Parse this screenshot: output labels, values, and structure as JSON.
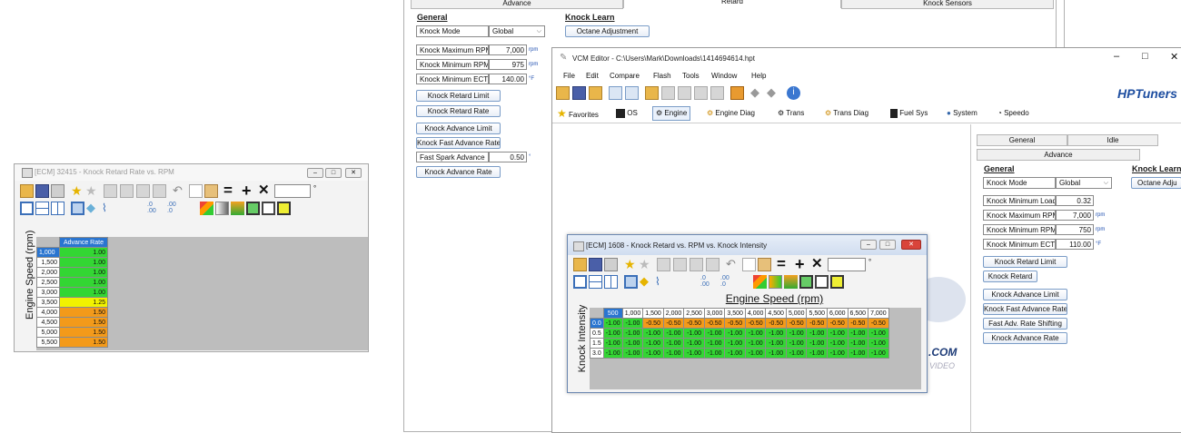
{
  "left_window": {
    "title": "[ECM] 32415 - Knock Retard Rate vs. RPM",
    "axis_label": "Engine Speed (rpm)",
    "column_header": "Advance Rate",
    "rows": [
      {
        "rpm": "1,000",
        "val": "1.00",
        "color": "#33d633"
      },
      {
        "rpm": "1,500",
        "val": "1.00",
        "color": "#33d633"
      },
      {
        "rpm": "2,000",
        "val": "1.00",
        "color": "#33d633"
      },
      {
        "rpm": "2,500",
        "val": "1.00",
        "color": "#33d633"
      },
      {
        "rpm": "3,000",
        "val": "1.00",
        "color": "#33d633"
      },
      {
        "rpm": "3,500",
        "val": "1.25",
        "color": "#f2f200"
      },
      {
        "rpm": "4,000",
        "val": "1.50",
        "color": "#f39a1a"
      },
      {
        "rpm": "4,500",
        "val": "1.50",
        "color": "#f39a1a"
      },
      {
        "rpm": "5,000",
        "val": "1.50",
        "color": "#f39a1a"
      },
      {
        "rpm": "5,500",
        "val": "1.50",
        "color": "#f39a1a"
      }
    ]
  },
  "bg_panel": {
    "tabs": [
      "Advance",
      "Retard",
      "Knock Sensors"
    ],
    "general_header": "General",
    "knock_learn_header": "Knock Learn",
    "knock_mode_label": "Knock Mode",
    "knock_mode_value": "Global",
    "octane_button": "Octane Adjustment",
    "fields": [
      {
        "label": "Knock Maximum RPM",
        "value": "7,000",
        "unit": "rpm"
      },
      {
        "label": "Knock Minimum RPM",
        "value": "975",
        "unit": "rpm"
      },
      {
        "label": "Knock Minimum ECT",
        "value": "140.00",
        "unit": "°F"
      }
    ],
    "buttons": [
      "Knock Retard Limit",
      "Knock Retard Rate",
      "Knock Advance Limit",
      "Knock Fast Advance Rate"
    ],
    "fast_spark_label": "Fast Spark Advance",
    "fast_spark_value": "0.50",
    "fast_spark_unit": "°",
    "advance_rate_button": "Knock Advance Rate"
  },
  "vcm": {
    "title": "VCM Editor - C:\\Users\\Mark\\Downloads\\1414694614.hpt",
    "menu": [
      "File",
      "Edit",
      "Compare",
      "Flash",
      "Tools",
      "Window",
      "Help"
    ],
    "nav": [
      "Favorites",
      "OS",
      "Engine",
      "Engine Diag",
      "Trans",
      "Trans Diag",
      "Fuel Sys",
      "System",
      "Speedo"
    ],
    "brand": "HPTuners",
    "watermark_bottom": "VIDEO",
    "watermark_com": ".COM",
    "right_panel": {
      "tabs_row1": [
        "General",
        "Idle"
      ],
      "tab_advance": "Advance",
      "general_header": "General",
      "knock_learn_header": "Knock Learn",
      "knock_mode_label": "Knock Mode",
      "knock_mode_value": "Global",
      "octane_button": "Octane Adju",
      "fields": [
        {
          "label": "Knock Minimum Load",
          "value": "0.32",
          "unit": ""
        },
        {
          "label": "Knock Maximum RPM",
          "value": "7,000",
          "unit": "rpm"
        },
        {
          "label": "Knock Minimum RPM",
          "value": "750",
          "unit": "rpm"
        },
        {
          "label": "Knock Minimum ECT",
          "value": "110.00",
          "unit": "°F"
        }
      ],
      "buttons": [
        "Knock Retard Limit",
        "Knock Retard",
        "Knock Advance Limit",
        "Knock Fast Advance Rate",
        "Fast Adv. Rate Shifting",
        "Knock Advance Rate"
      ]
    }
  },
  "knock_window": {
    "title": "[ECM] 1608 - Knock Retard vs. RPM vs. Knock Intensity",
    "x_axis": "Engine Speed (rpm)",
    "y_axis": "Knock Intensity",
    "col_headers": [
      "500",
      "1,000",
      "1,500",
      "2,000",
      "2,500",
      "3,000",
      "3,500",
      "4,000",
      "4,500",
      "5,000",
      "5,500",
      "6,000",
      "6,500",
      "7,000"
    ],
    "rows": [
      {
        "h": "0.0",
        "vals": [
          "-1.00",
          "-1.00",
          "-0.50",
          "-0.50",
          "-0.50",
          "-0.50",
          "-0.50",
          "-0.50",
          "-0.50",
          "-0.50",
          "-0.50",
          "-0.50",
          "-0.50",
          "-0.50"
        ],
        "colors": [
          "g",
          "g",
          "o",
          "o",
          "o",
          "o",
          "o",
          "o",
          "o",
          "o",
          "o",
          "o",
          "o",
          "o"
        ]
      },
      {
        "h": "0.5",
        "vals": [
          "-1.00",
          "-1.00",
          "-1.00",
          "-1.00",
          "-1.00",
          "-1.00",
          "-1.00",
          "-1.00",
          "-1.00",
          "-1.00",
          "-1.00",
          "-1.00",
          "-1.00",
          "-1.00"
        ],
        "colors": [
          "g",
          "g",
          "g",
          "g",
          "g",
          "g",
          "g",
          "g",
          "g",
          "g",
          "g",
          "g",
          "g",
          "g"
        ]
      },
      {
        "h": "1.5",
        "vals": [
          "-1.00",
          "-1.00",
          "-1.00",
          "-1.00",
          "-1.00",
          "-1.00",
          "-1.00",
          "-1.00",
          "-1.00",
          "-1.00",
          "-1.00",
          "-1.00",
          "-1.00",
          "-1.00"
        ],
        "colors": [
          "g",
          "g",
          "g",
          "g",
          "g",
          "g",
          "g",
          "g",
          "g",
          "g",
          "g",
          "g",
          "g",
          "g"
        ]
      },
      {
        "h": "3.0",
        "vals": [
          "-1.00",
          "-1.00",
          "-1.00",
          "-1.00",
          "-1.00",
          "-1.00",
          "-1.00",
          "-1.00",
          "-1.00",
          "-1.00",
          "-1.00",
          "-1.00",
          "-1.00",
          "-1.00"
        ],
        "colors": [
          "g",
          "g",
          "g",
          "g",
          "g",
          "g",
          "g",
          "g",
          "g",
          "g",
          "g",
          "g",
          "g",
          "g"
        ]
      }
    ]
  }
}
